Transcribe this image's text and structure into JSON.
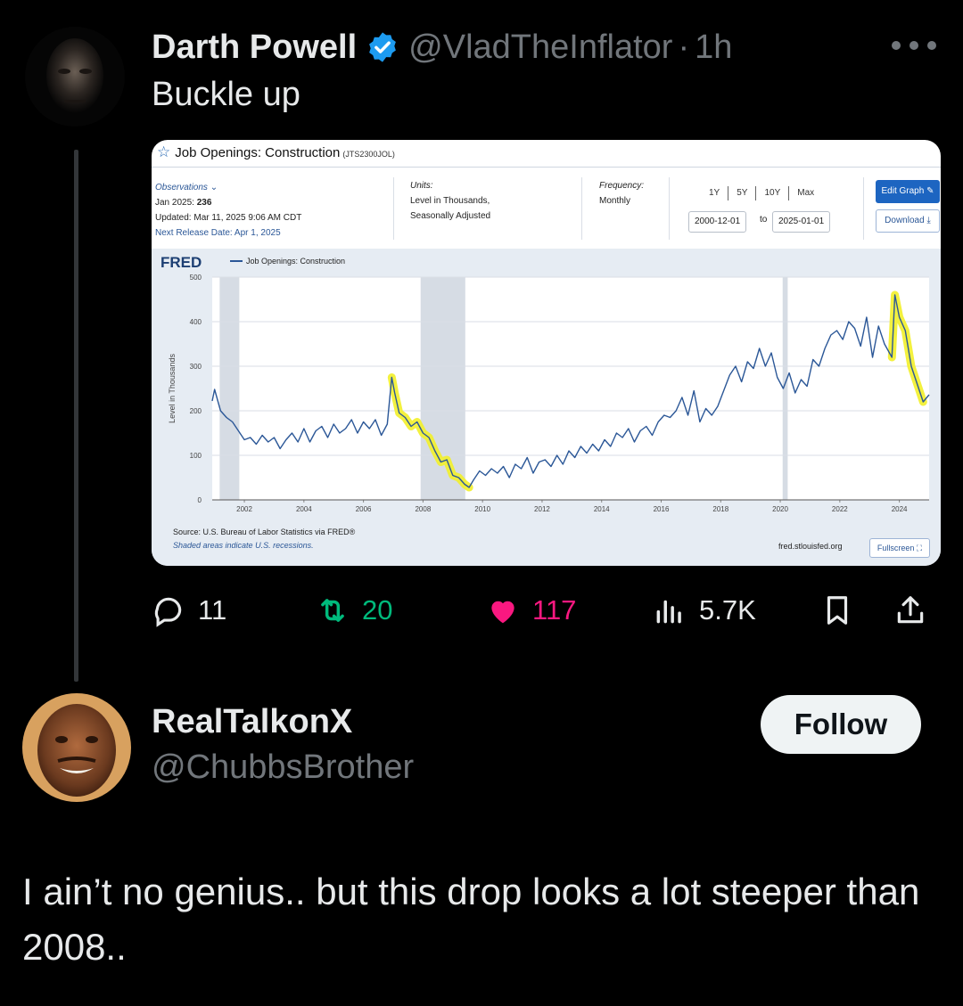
{
  "tweet": {
    "author_name": "Darth Powell",
    "author_handle": "@VladTheInflator",
    "separator": "·",
    "time": "1h",
    "text": "Buckle up",
    "icons": {
      "verified": "verified-badge-icon",
      "more": "more-icon"
    }
  },
  "fred": {
    "title": "Job Openings: Construction",
    "series_code": "(JTS2300JOL)",
    "observations_label": "Observations",
    "obs_date": "Jan 2025:",
    "obs_value": "236",
    "updated": "Updated: Mar 11, 2025 9:06 AM CDT",
    "next_release": "Next Release Date: Apr 1, 2025",
    "units_label": "Units:",
    "units_line1": "Level in Thousands,",
    "units_line2": "Seasonally Adjusted",
    "frequency_label": "Frequency:",
    "frequency_value": "Monthly",
    "range_buttons": [
      "1Y",
      "5Y",
      "10Y",
      "Max"
    ],
    "date_from": "2000-12-01",
    "date_to_label": "to",
    "date_to": "2025-01-01",
    "edit_graph": "Edit Graph",
    "download": "Download",
    "logo": "FRED",
    "legend": "Job Openings: Construction",
    "source": "Source: U.S. Bureau of Labor Statistics via FRED®",
    "shaded_note": "Shaded areas indicate U.S. recessions.",
    "site": "fred.stlouisfed.org",
    "fullscreen": "Fullscreen"
  },
  "chart_data": {
    "type": "line",
    "title": "",
    "xlabel": "",
    "ylabel": "Level in Thousands",
    "xlim": [
      2000.92,
      2025.0
    ],
    "ylim": [
      0,
      500
    ],
    "x_ticks": [
      "2002",
      "2004",
      "2006",
      "2008",
      "2010",
      "2012",
      "2014",
      "2016",
      "2018",
      "2020",
      "2022",
      "2024"
    ],
    "y_ticks": [
      "0",
      "100",
      "200",
      "300",
      "400",
      "500"
    ],
    "grid": true,
    "legend_position": "top-left",
    "recessions": [
      [
        2001.17,
        2001.83
      ],
      [
        2007.92,
        2009.42
      ],
      [
        2020.08,
        2020.25
      ]
    ],
    "highlights": [
      [
        2006.9,
        2009.55
      ],
      [
        2023.75,
        2024.95
      ]
    ],
    "colors": {
      "line": "#2b5797",
      "highlight": "#f2ef2a",
      "recession": "#d6dce4"
    },
    "series": [
      {
        "x": [
          2000.92,
          2001.0,
          2001.2,
          2001.4,
          2001.6,
          2001.8,
          2002.0,
          2002.2,
          2002.4,
          2002.6,
          2002.8,
          2003.0,
          2003.2,
          2003.4,
          2003.6,
          2003.8,
          2004.0,
          2004.2,
          2004.4,
          2004.6,
          2004.8,
          2005.0,
          2005.2,
          2005.4,
          2005.6,
          2005.8,
          2006.0,
          2006.2,
          2006.4,
          2006.6,
          2006.8,
          2006.95,
          2007.05,
          2007.2,
          2007.4,
          2007.6,
          2007.8,
          2008.0,
          2008.2,
          2008.4,
          2008.6,
          2008.8,
          2009.0,
          2009.2,
          2009.4,
          2009.55,
          2009.7,
          2009.9,
          2010.1,
          2010.3,
          2010.5,
          2010.7,
          2010.9,
          2011.1,
          2011.3,
          2011.5,
          2011.7,
          2011.9,
          2012.1,
          2012.3,
          2012.5,
          2012.7,
          2012.9,
          2013.1,
          2013.3,
          2013.5,
          2013.7,
          2013.9,
          2014.1,
          2014.3,
          2014.5,
          2014.7,
          2014.9,
          2015.1,
          2015.3,
          2015.5,
          2015.7,
          2015.9,
          2016.1,
          2016.3,
          2016.5,
          2016.7,
          2016.9,
          2017.1,
          2017.3,
          2017.5,
          2017.7,
          2017.9,
          2018.1,
          2018.3,
          2018.5,
          2018.7,
          2018.9,
          2019.1,
          2019.3,
          2019.5,
          2019.7,
          2019.9,
          2020.1,
          2020.3,
          2020.5,
          2020.7,
          2020.9,
          2021.1,
          2021.3,
          2021.5,
          2021.7,
          2021.9,
          2022.1,
          2022.3,
          2022.5,
          2022.7,
          2022.9,
          2023.1,
          2023.3,
          2023.5,
          2023.75,
          2023.85,
          2024.0,
          2024.2,
          2024.4,
          2024.6,
          2024.8,
          2025.0
        ],
        "values": [
          222,
          248,
          200,
          185,
          175,
          155,
          135,
          140,
          125,
          145,
          130,
          140,
          115,
          135,
          150,
          130,
          160,
          130,
          155,
          165,
          140,
          170,
          150,
          160,
          180,
          150,
          175,
          160,
          180,
          145,
          170,
          275,
          240,
          195,
          185,
          165,
          175,
          150,
          140,
          110,
          85,
          90,
          55,
          50,
          35,
          28,
          45,
          65,
          55,
          70,
          60,
          75,
          50,
          80,
          70,
          95,
          60,
          85,
          90,
          75,
          100,
          80,
          110,
          95,
          120,
          105,
          125,
          110,
          135,
          120,
          150,
          140,
          160,
          130,
          155,
          165,
          145,
          175,
          190,
          185,
          200,
          230,
          190,
          245,
          175,
          205,
          190,
          210,
          245,
          280,
          300,
          265,
          310,
          295,
          340,
          300,
          330,
          275,
          250,
          285,
          240,
          270,
          255,
          315,
          300,
          340,
          370,
          380,
          360,
          400,
          385,
          345,
          410,
          320,
          390,
          350,
          320,
          460,
          410,
          380,
          300,
          260,
          220,
          236
        ]
      }
    ]
  },
  "stats": {
    "replies": "11",
    "reposts": "20",
    "likes": "117",
    "views": "5.7K",
    "icons": [
      "reply-icon",
      "repost-icon",
      "like-icon",
      "views-icon",
      "bookmark-icon",
      "share-icon"
    ],
    "colors": {
      "repost": "#00ba7c",
      "like": "#f91880",
      "muted": "#71767b"
    }
  },
  "reply": {
    "author_name": "RealTalkonX",
    "author_handle": "@ChubbsBrother",
    "follow_label": "Follow",
    "text": "I ain’t no genius.. but this drop looks a lot steeper than 2008.."
  }
}
